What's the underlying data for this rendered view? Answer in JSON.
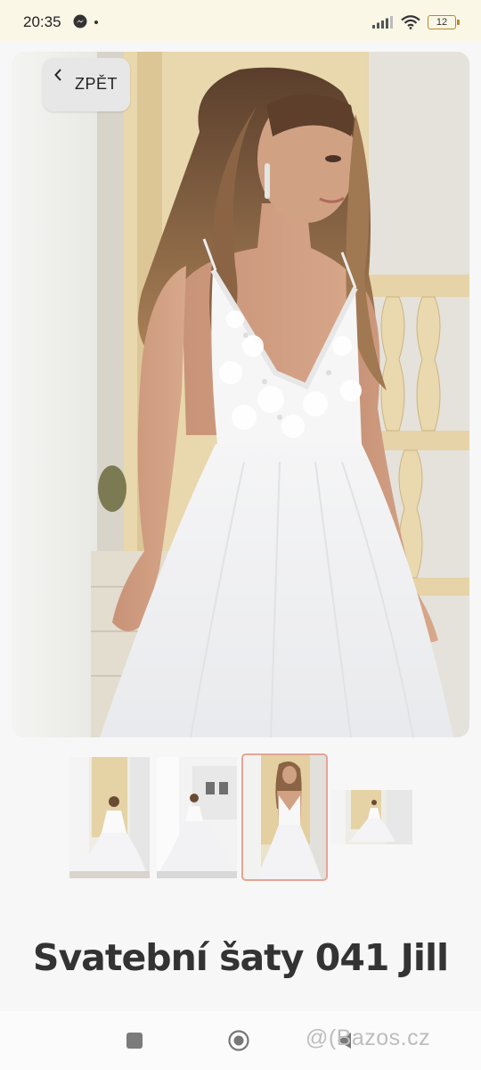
{
  "status_bar": {
    "time": "20:35",
    "battery": "12",
    "icons": [
      "messenger-icon",
      "signal-icon",
      "wifi-icon",
      "battery-icon"
    ]
  },
  "gallery": {
    "back_label": "ZPĚT",
    "main_image": "bride-white-tulle-dress-photo",
    "thumbnails": [
      {
        "name": "thumb-1",
        "selected": false
      },
      {
        "name": "thumb-2",
        "selected": false
      },
      {
        "name": "thumb-3",
        "selected": true
      },
      {
        "name": "thumb-4",
        "selected": false
      }
    ]
  },
  "listing": {
    "title": "Svatební šaty 041 Jill"
  },
  "nav": {
    "buttons": [
      "recents-button",
      "home-button",
      "back-button"
    ]
  },
  "watermark": "@(Bazos.cz",
  "colors": {
    "accent_border": "#e2a596",
    "status_bg": "#fbf7e6",
    "title": "#333333"
  }
}
